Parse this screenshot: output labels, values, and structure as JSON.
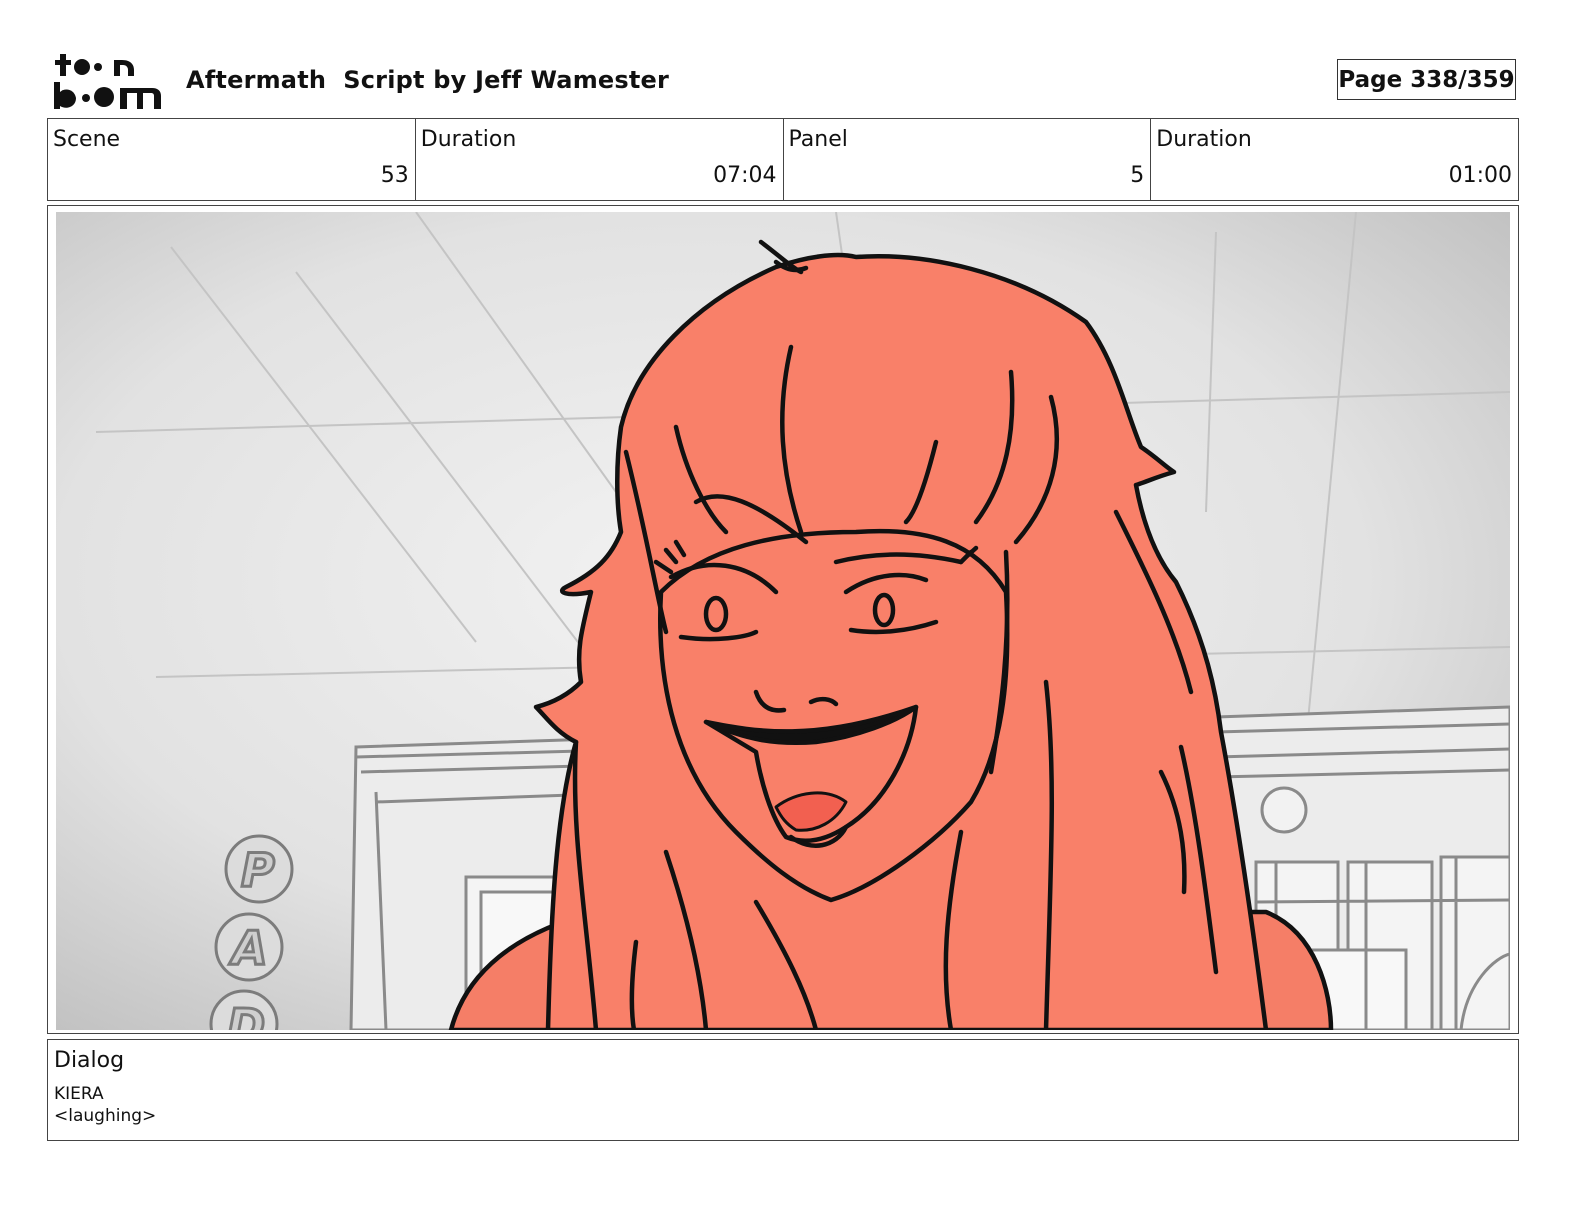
{
  "header": {
    "logo_top": "toon",
    "logo_bottom": "boom",
    "title": "Aftermath  Script by Jeff Wamester",
    "page": "Page 338/359"
  },
  "info": {
    "scene_label": "Scene",
    "scene_value": "53",
    "scene_duration_label": "Duration",
    "scene_duration_value": "07:04",
    "panel_label": "Panel",
    "panel_value": "5",
    "panel_duration_label": "Duration",
    "panel_duration_value": "01:00"
  },
  "panel": {
    "sign_letters": [
      "P",
      "A",
      "D"
    ],
    "hair_color": "#f98069",
    "line_color": "#111111",
    "background_color": "#d8d8d8"
  },
  "dialog": {
    "label": "Dialog",
    "character": "KIERA",
    "line": "<laughing>"
  }
}
